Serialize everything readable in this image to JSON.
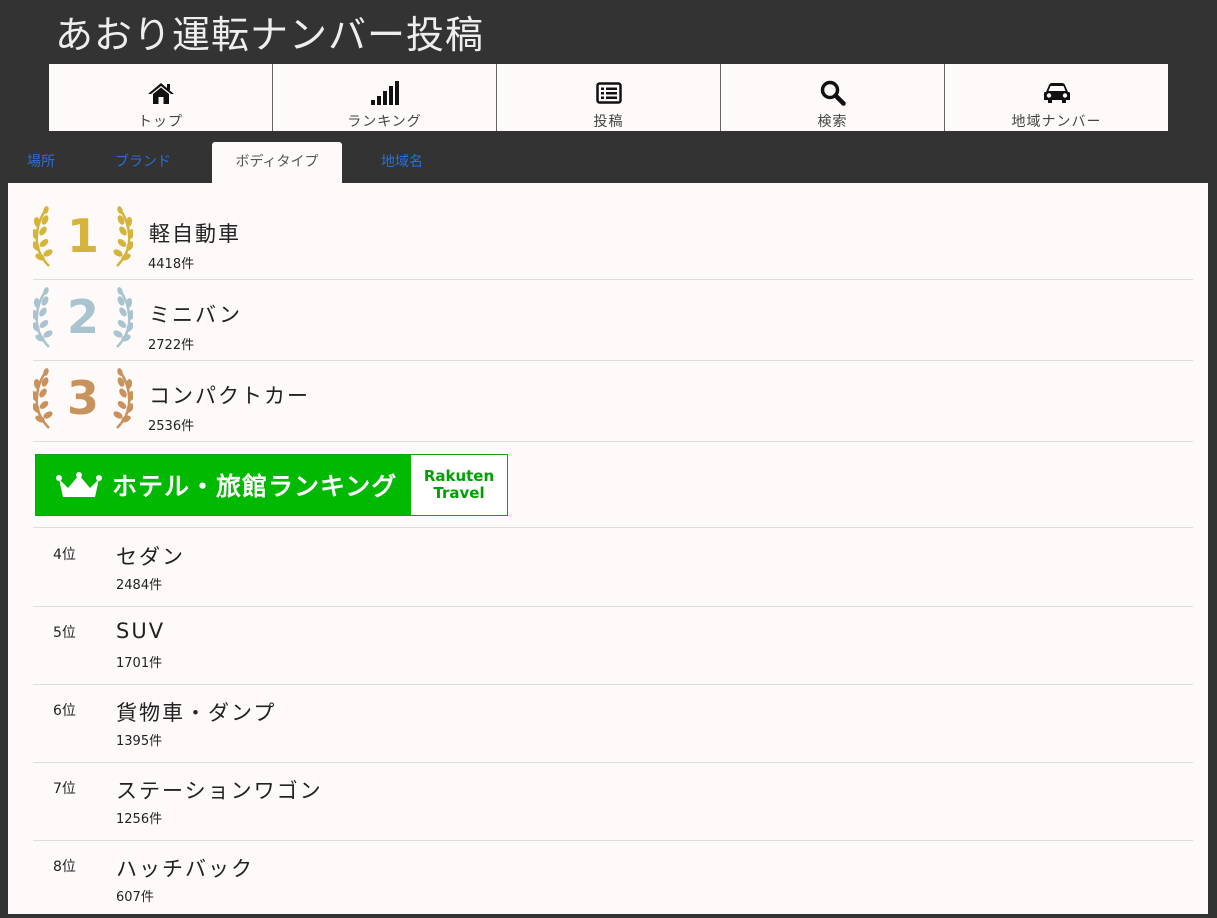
{
  "site": {
    "title": "あおり運転ナンバー投稿"
  },
  "nav": [
    {
      "label": "トップ",
      "icon": "home-icon"
    },
    {
      "label": "ランキング",
      "icon": "signal-bars-icon"
    },
    {
      "label": "投稿",
      "icon": "list-icon"
    },
    {
      "label": "検索",
      "icon": "search-icon"
    },
    {
      "label": "地域ナンバー",
      "icon": "car-icon"
    }
  ],
  "tabs": [
    {
      "label": "場所"
    },
    {
      "label": "ブランド"
    },
    {
      "label": "ボディタイプ",
      "active": true
    },
    {
      "label": "地域名"
    }
  ],
  "top_rankings": [
    {
      "rank": "1",
      "name": "軽自動車",
      "count": "4418件",
      "color": "#d4b43a"
    },
    {
      "rank": "2",
      "name": "ミニバン",
      "count": "2722件",
      "color": "#a9c3cf"
    },
    {
      "rank": "3",
      "name": "コンパクトカー",
      "count": "2536件",
      "color": "#c8925c"
    }
  ],
  "banner": {
    "text": "ホテル・旅館ランキング",
    "logo_line1": "Rakuten",
    "logo_line2": "Travel",
    "color": "#00b900"
  },
  "rankings": [
    {
      "rank": "4位",
      "name": "セダン",
      "count": "2484件"
    },
    {
      "rank": "5位",
      "name": "SUV",
      "count": "1701件"
    },
    {
      "rank": "6位",
      "name": "貨物車・ダンプ",
      "count": "1395件"
    },
    {
      "rank": "7位",
      "name": "ステーションワゴン",
      "count": "1256件"
    },
    {
      "rank": "8位",
      "name": "ハッチバック",
      "count": "607件"
    }
  ]
}
